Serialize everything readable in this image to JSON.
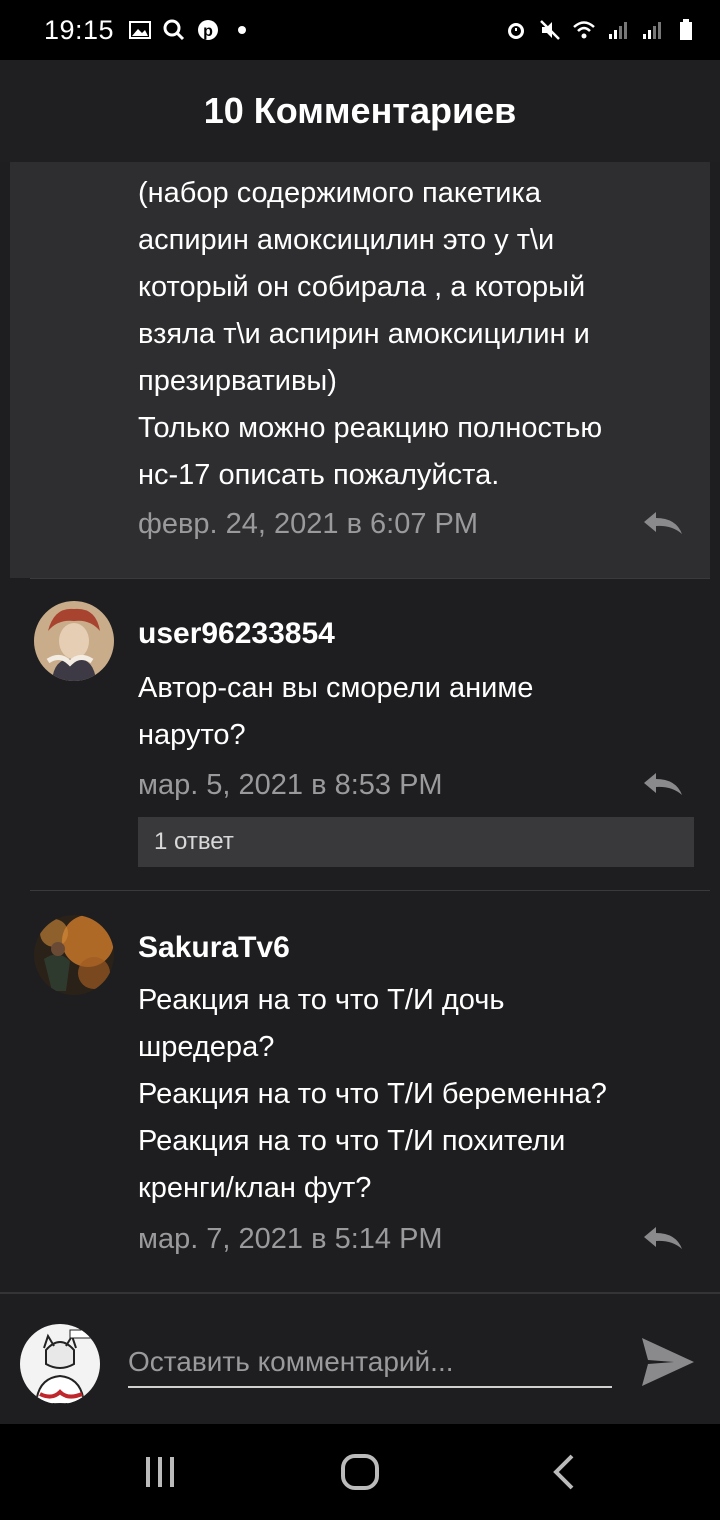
{
  "status_bar": {
    "time": "19:15",
    "left_icons": [
      "gallery-icon",
      "search-icon",
      "pinterest-icon",
      "dot-icon"
    ],
    "right_icons": [
      "alarm-icon",
      "mute-icon",
      "wifi-icon",
      "signal-icon",
      "signal-icon",
      "battery-icon"
    ]
  },
  "header": {
    "title": "10 Комментариев"
  },
  "comments": [
    {
      "text": "(набор содержимого пакетика\nаспирин амоксицилин это у т\\и\nкоторый он собирала , а который\nвзяла т\\и аспирин амоксицилин и\nпрезирвативы)\nТолько можно реакцию полностью\nнс-17 описать пожалуйста.",
      "date": "февр. 24, 2021 в 6:07 PM"
    },
    {
      "author": "user96233854",
      "text": "Автор-сан вы сморели аниме\nнаруто?",
      "date": "мар. 5, 2021 в 8:53 PM",
      "replies": "1 ответ"
    },
    {
      "author": "SakuraTv6",
      "text": "Реакция на то что Т/И дочь\nшредера?\nРеакция на то что Т/И беременна?\nРеакция на то что Т/И похители\nкренги/клан фут?",
      "date": "мар. 7, 2021 в 5:14 PM"
    }
  ],
  "composer": {
    "placeholder": "Оставить комментарий..."
  },
  "nav": {
    "items": [
      "recent-apps-icon",
      "home-icon",
      "back-icon"
    ]
  },
  "colors": {
    "background": "#1e1e20",
    "highlight": "#2e2e30",
    "muted_text": "#9a9a9c",
    "reply_box": "#39393b"
  }
}
